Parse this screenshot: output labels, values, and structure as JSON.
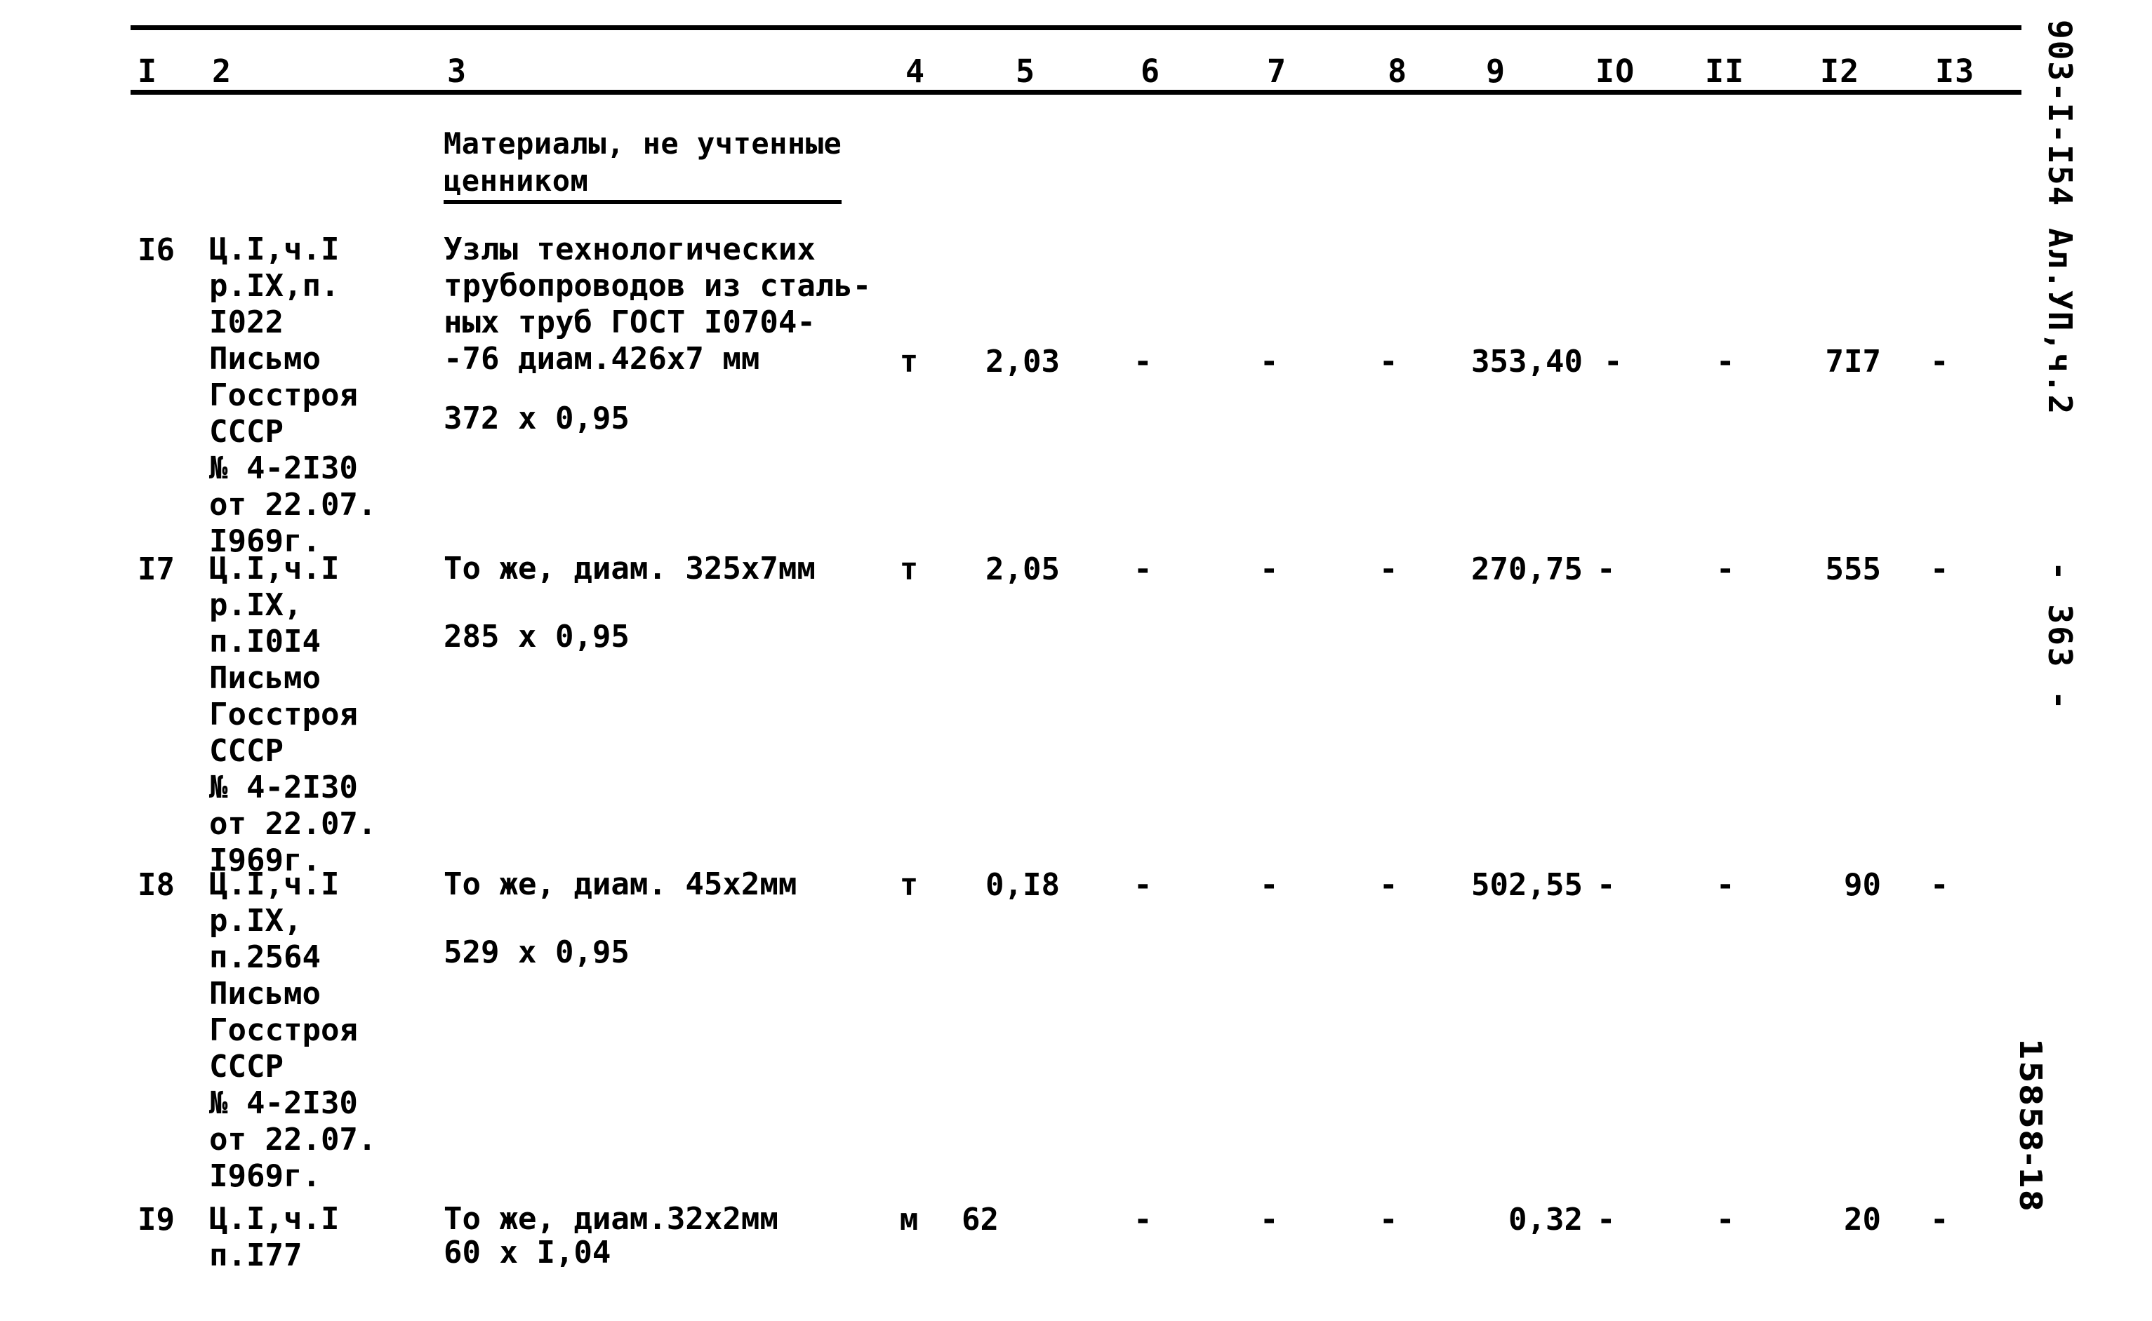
{
  "document": {
    "code": "903-I-I54  Ал.УП,ч.2",
    "page_number": "-  363  -",
    "stamp_number": "15858-18"
  },
  "table": {
    "column_headers": [
      "I",
      "2",
      "3",
      "4",
      "5",
      "6",
      "7",
      "8",
      "9",
      "IO",
      "II",
      "I2",
      "I3"
    ],
    "section_title": "Материалы, не учтенные\nценником",
    "rows": [
      {
        "num": "I6",
        "justification": "Ц.I,ч.I\nр.IX,п.\nI022\nПисьмо\nГосстроя\nСССР\n№ 4-2I30\nот 22.07.\nI969г.",
        "description": "Узлы технологических\nтрубопроводов из сталь-\nных труб ГОСТ I0704-\n-76 диам.426х7 мм",
        "calculation": "372 х 0,95",
        "unit": "т",
        "c5": "2,03",
        "c6": "-",
        "c7": "-",
        "c8": "-",
        "c9": "353,40",
        "c10": "-",
        "c11": "-",
        "c12": "7I7",
        "c13": "-"
      },
      {
        "num": "I7",
        "justification": "Ц.I,ч.I\nр.IX,\nп.I0I4\nПисьмо\nГосстроя\nСССР\n№ 4-2I30\nот 22.07.\nI969г.",
        "description": "То же, диам. 325х7мм",
        "calculation": "285 х 0,95",
        "unit": "т",
        "c5": "2,05",
        "c6": "-",
        "c7": "-",
        "c8": "-",
        "c9": "270,75",
        "c10": "-",
        "c11": "-",
        "c12": "555",
        "c13": "-"
      },
      {
        "num": "I8",
        "justification": "Ц.I,ч.I\nр.IX,\nп.2564\nПисьмо\nГосстроя\nСССР\n№ 4-2I30\nот 22.07.\nI969г.",
        "description": "То же, диам. 45х2мм",
        "calculation": "529 х 0,95",
        "unit": "т",
        "c5": "0,I8",
        "c6": "-",
        "c7": "-",
        "c8": "-",
        "c9": "502,55",
        "c10": "-",
        "c11": "-",
        "c12": "90",
        "c13": "-"
      },
      {
        "num": "I9",
        "justification": "Ц.I,ч.I\nп.I77",
        "description": "То же, диам.32х2мм",
        "calculation": "60 х I,04",
        "unit": "м",
        "c5": "62",
        "c6": "-",
        "c7": "-",
        "c8": "-",
        "c9": "0,32",
        "c10": "-",
        "c11": "-",
        "c12": "20",
        "c13": "-"
      }
    ]
  }
}
